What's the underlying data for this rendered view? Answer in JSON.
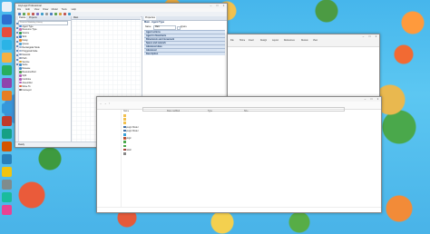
{
  "desktop": {
    "icons": [
      "",
      "",
      "",
      "",
      "",
      "",
      "",
      "",
      "",
      "",
      "",
      "",
      "",
      "",
      "",
      "",
      ""
    ]
  },
  "anylogic": {
    "title": "AnyLogic Professional",
    "menu": [
      "File",
      "Edit",
      "View",
      "Draw",
      "Model",
      "Tools",
      "Help"
    ],
    "palette": {
      "tabs": [
        "Palette",
        "Projects"
      ],
      "search_placeholder": "Process Modeling Library",
      "items": [
        {
          "label": "Agent Type",
          "color": "#4a8bd6"
        },
        {
          "label": "Resource Type",
          "color": "#c76ab1"
        },
        {
          "label": "Source",
          "color": "#2e9b4a"
        },
        {
          "label": "Sink",
          "color": "#3a7ac9"
        },
        {
          "label": "Delay",
          "color": "#e68a2e"
        },
        {
          "label": "Queue",
          "color": "#4aa5d8"
        },
        {
          "label": "Rectangular Node",
          "color": "#9fb3cc"
        },
        {
          "label": "Polygonal Node",
          "color": "#9fb3cc"
        },
        {
          "label": "Network",
          "color": "#8e9bb0"
        },
        {
          "label": "Path",
          "color": "#8e9bb0"
        },
        {
          "label": "Service",
          "color": "#d5a52e"
        },
        {
          "label": "Seize",
          "color": "#3f8fce"
        },
        {
          "label": "Release",
          "color": "#3f8fce"
        },
        {
          "label": "ResourcePool",
          "color": "#4d9c50"
        },
        {
          "label": "Split",
          "color": "#b45dbb"
        },
        {
          "label": "Combine",
          "color": "#b45dbb"
        },
        {
          "label": "Assembler",
          "color": "#b45dbb"
        },
        {
          "label": "Move To",
          "color": "#e2603d"
        },
        {
          "label": "Conveyor",
          "color": "#777"
        }
      ]
    },
    "canvas_tab": "Main",
    "properties": {
      "tab": "Properties",
      "header": "Main - Agent Type",
      "name_label": "Name:",
      "name_value": "Main",
      "ignore_label": "Ignore",
      "sections": [
        "Agent actions",
        "Agent in flowcharts",
        "Dimensions and movement",
        "Space and network",
        "Advanced Java",
        "Advanced",
        "Description"
      ]
    },
    "status": {
      "left": "Ready",
      "right": "Free memory"
    }
  },
  "docwin": {
    "title": "",
    "ribbon": [
      "File",
      "Home",
      "Insert",
      "Design",
      "Layout",
      "References",
      "Review",
      "View"
    ],
    "text_lines": [
      ""
    ]
  },
  "explorer": {
    "title": "",
    "address": "",
    "nav": [
      "",
      "",
      "",
      "",
      "",
      "",
      "",
      "",
      "",
      ""
    ],
    "headers": [
      "Name",
      "Date modified",
      "Type",
      "Size"
    ],
    "rows": [
      {
        "name": "",
        "date": "",
        "type": "",
        "size": "",
        "color": "#f2c14e"
      },
      {
        "name": "",
        "date": "",
        "type": "",
        "size": "",
        "color": "#f2c14e"
      },
      {
        "name": "",
        "date": "",
        "type": "",
        "size": "",
        "color": "#f2c14e"
      },
      {
        "name": "AnyLogic Model",
        "date": "",
        "type": "",
        "size": "",
        "color": "#4a8bd6"
      },
      {
        "name": "AnyLogic Model",
        "date": "",
        "type": "",
        "size": "",
        "color": "#4a8bd6"
      },
      {
        "name": "",
        "date": "",
        "type": "",
        "size": "",
        "color": "#3aa0d8"
      },
      {
        "name": "Anylogic",
        "date": "",
        "type": "",
        "size": "",
        "color": "#e2603d"
      },
      {
        "name": "",
        "date": "",
        "type": "",
        "size": "",
        "color": "#4aa84b"
      },
      {
        "name": "",
        "date": "",
        "type": "",
        "size": "",
        "color": "#4aa84b"
      },
      {
        "name": "uninstall",
        "date": "",
        "type": "",
        "size": "",
        "color": "#d04a3a"
      },
      {
        "name": "",
        "date": "",
        "type": "",
        "size": "",
        "color": "#888"
      }
    ],
    "status": ""
  }
}
